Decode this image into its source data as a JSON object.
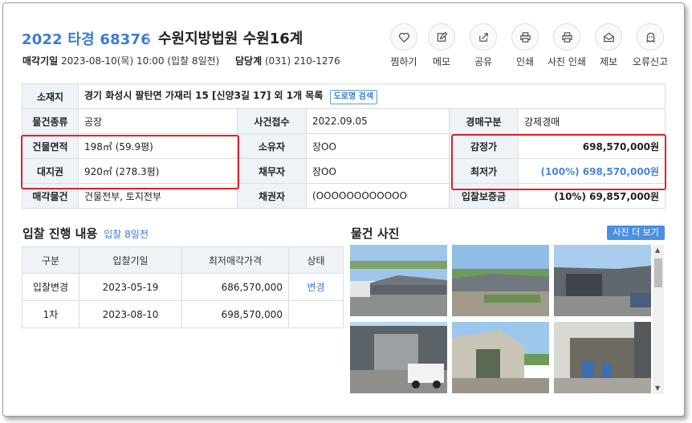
{
  "header": {
    "case_no": "2022 타경 68376",
    "court": "수원지방법원 수원16계",
    "sale_date_label": "매각기일",
    "sale_date": "2023-08-10(목) 10:00 (입찰 8일전)",
    "manager_label": "담당계",
    "manager_phone": "(031) 210-1276"
  },
  "actions": [
    {
      "label": "찜하기",
      "icon": "heart-icon"
    },
    {
      "label": "메모",
      "icon": "pencil-icon"
    },
    {
      "label": "공유",
      "icon": "share-icon"
    },
    {
      "label": "인쇄",
      "icon": "printer-icon"
    },
    {
      "label": "사진 인쇄",
      "icon": "printer-icon"
    },
    {
      "label": "제보",
      "icon": "envelope-icon"
    },
    {
      "label": "오류신고",
      "icon": "ghost-icon"
    }
  ],
  "info": {
    "location_label": "소재지",
    "location": "경기 화성시 팔탄면 가재리 15 [신양3길 17] 외 1개 목록",
    "road_search": "도로명 검색",
    "item_type_label": "물건종류",
    "item_type": "공장",
    "case_received_label": "사건접수",
    "case_received": "2022.09.05",
    "auction_type_label": "경매구분",
    "auction_type": "강제경매",
    "building_area_label": "건물면적",
    "building_area": "198㎡ (59.9평)",
    "owner_label": "소유자",
    "owner": "장OO",
    "appraisal_label": "감정가",
    "appraisal": "698,570,000원",
    "land_right_label": "대지권",
    "land_right": "920㎡ (278.3평)",
    "debtor_label": "채무자",
    "debtor": "장OO",
    "min_price_label": "최저가",
    "min_price": "(100%) 698,570,000원",
    "sale_item_label": "매각물건",
    "sale_item": "건물전부, 토지전부",
    "creditor_label": "채권자",
    "creditor": "(OOOOOOOOOOOO",
    "deposit_label": "입찰보증금",
    "deposit": "(10%) 69,857,000원"
  },
  "bid_section": {
    "title": "입찰 진행 내용",
    "subtitle": "입찰 8일전",
    "columns": [
      "구분",
      "입찰기일",
      "최저매각가격",
      "상태"
    ],
    "rows": [
      {
        "type": "입찰변경",
        "date": "2023-05-19",
        "price": "686,570,000",
        "state": "변경"
      },
      {
        "type": "1차",
        "date": "2023-08-10",
        "price": "698,570,000",
        "state": ""
      }
    ]
  },
  "photo_section": {
    "title": "물건 사진",
    "more_button": "사진 더 보기"
  },
  "colors": {
    "accent": "#3a7bd5",
    "header_cell_bg": "#eef3f8",
    "highlight_box": "#e0202a",
    "button_blue": "#4a90e2"
  }
}
